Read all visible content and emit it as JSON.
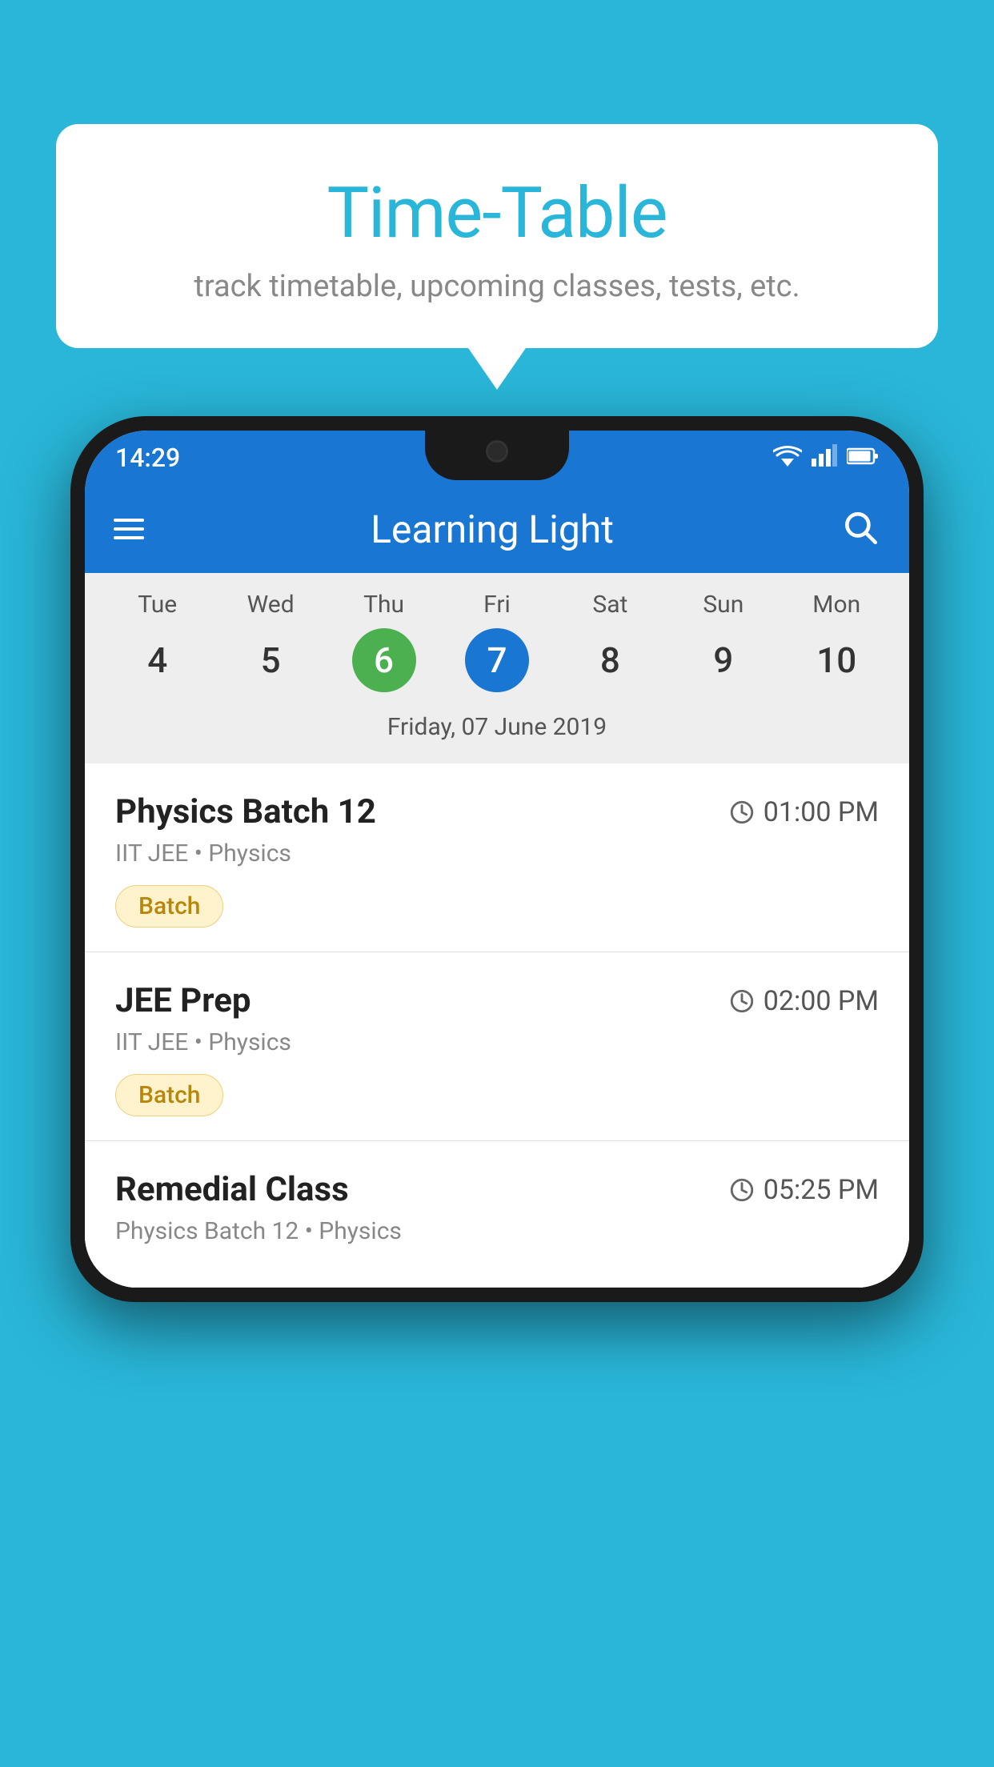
{
  "page": {
    "background_color": "#29b6d8"
  },
  "speech_bubble": {
    "title": "Time-Table",
    "subtitle": "track timetable, upcoming classes, tests, etc."
  },
  "phone": {
    "status_bar": {
      "time": "14:29"
    },
    "app_bar": {
      "title": "Learning Light",
      "menu_icon": "menu-icon",
      "search_icon": "search-icon"
    },
    "calendar": {
      "days": [
        {
          "label": "Tue",
          "num": "4",
          "state": "normal"
        },
        {
          "label": "Wed",
          "num": "5",
          "state": "normal"
        },
        {
          "label": "Thu",
          "num": "6",
          "state": "today"
        },
        {
          "label": "Fri",
          "num": "7",
          "state": "selected"
        },
        {
          "label": "Sat",
          "num": "8",
          "state": "normal"
        },
        {
          "label": "Sun",
          "num": "9",
          "state": "normal"
        },
        {
          "label": "Mon",
          "num": "10",
          "state": "normal"
        }
      ],
      "selected_date_label": "Friday, 07 June 2019"
    },
    "schedule": {
      "items": [
        {
          "title": "Physics Batch 12",
          "time": "01:00 PM",
          "subtitle": "IIT JEE • Physics",
          "badge": "Batch"
        },
        {
          "title": "JEE Prep",
          "time": "02:00 PM",
          "subtitle": "IIT JEE • Physics",
          "badge": "Batch"
        },
        {
          "title": "Remedial Class",
          "time": "05:25 PM",
          "subtitle": "Physics Batch 12 • Physics",
          "badge": null
        }
      ]
    }
  }
}
